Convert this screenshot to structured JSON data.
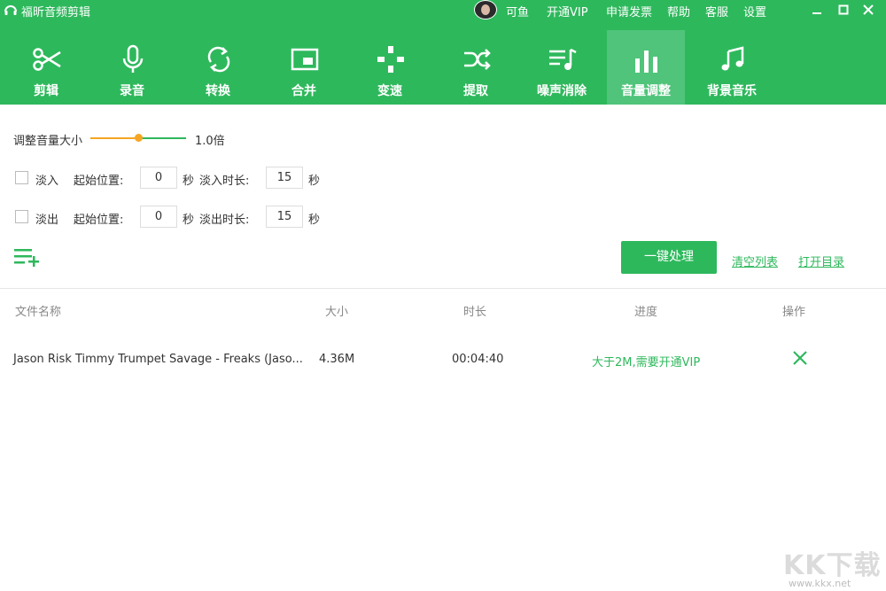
{
  "app": {
    "title": "福昕音频剪辑",
    "username": "可鱼"
  },
  "topbar": {
    "links": [
      "开通VIP",
      "申请发票",
      "帮助",
      "客服",
      "设置"
    ]
  },
  "tools": [
    {
      "label": "剪辑",
      "icon": "scissors-icon"
    },
    {
      "label": "录音",
      "icon": "microphone-icon"
    },
    {
      "label": "转换",
      "icon": "convert-icon"
    },
    {
      "label": "合并",
      "icon": "merge-icon"
    },
    {
      "label": "变速",
      "icon": "speed-icon"
    },
    {
      "label": "提取",
      "icon": "extract-icon"
    },
    {
      "label": "噪声消除",
      "icon": "noise-reduction-icon"
    },
    {
      "label": "音量调整",
      "icon": "volume-icon",
      "active": true
    },
    {
      "label": "背景音乐",
      "icon": "music-note-icon"
    }
  ],
  "volume": {
    "label": "调整音量大小",
    "value_text": "1.0倍",
    "slider_fraction": 0.5
  },
  "fade_in": {
    "label": "淡入",
    "checked": false,
    "start_label": "起始位置:",
    "start_value": "0",
    "sec_unit": "秒",
    "duration_label": "淡入时长:",
    "duration_value": "15"
  },
  "fade_out": {
    "label": "淡出",
    "checked": false,
    "start_label": "起始位置:",
    "start_value": "0",
    "sec_unit": "秒",
    "duration_label": "淡出时长:",
    "duration_value": "15"
  },
  "actions": {
    "process": "一键处理",
    "clear": "清空列表",
    "open_dir": "打开目录"
  },
  "table": {
    "headers": [
      "文件名称",
      "大小",
      "时长",
      "进度",
      "操作"
    ],
    "rows": [
      {
        "name": "Jason Risk Timmy Trumpet Savage - Freaks (Jaso...",
        "size": "4.36M",
        "duration": "00:04:40",
        "progress": "大于2M,需要开通VIP"
      }
    ]
  },
  "watermark": {
    "big": "KK下载",
    "small": "www.kkx.net"
  },
  "colors": {
    "brand": "#2eb85c",
    "slider": "#f5a623"
  }
}
